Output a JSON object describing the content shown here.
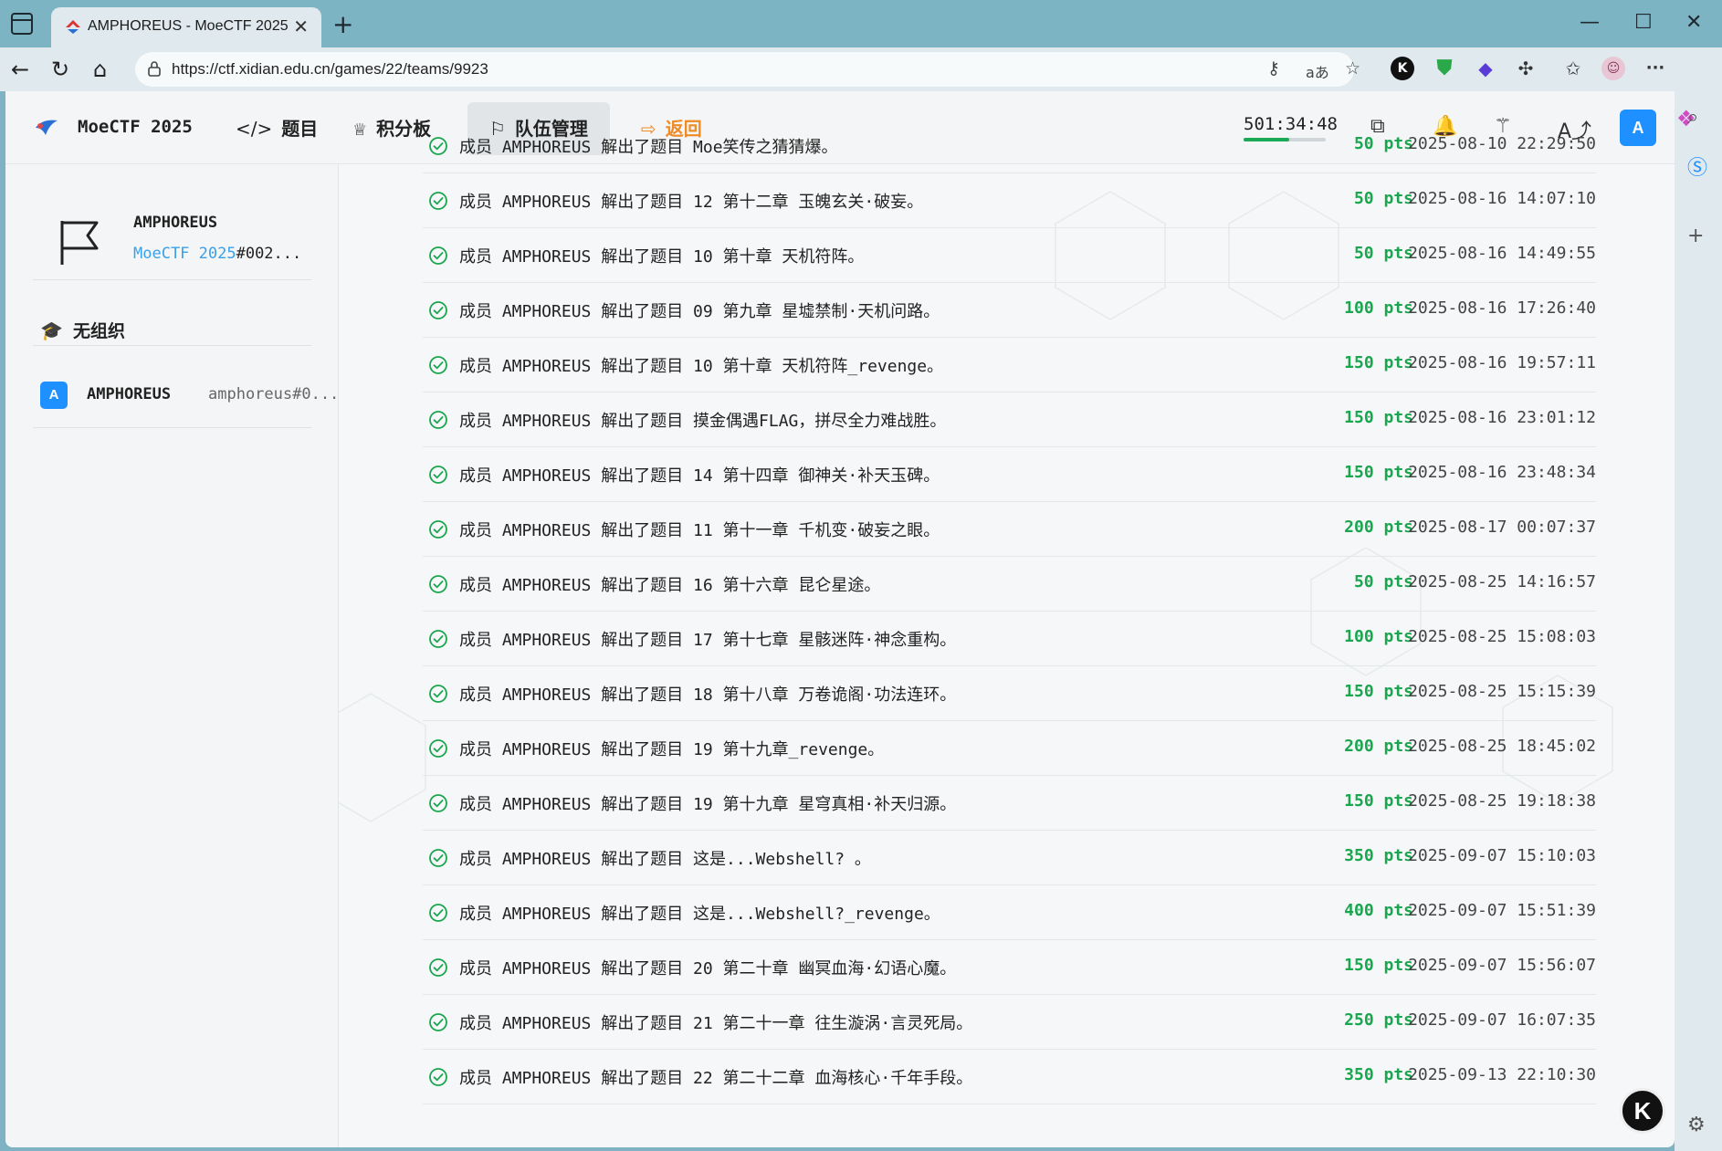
{
  "browser": {
    "tab_title": "AMPHOREUS - MoeCTF 2025",
    "tab_close": "✕",
    "new_tab": "+",
    "url": "https://ctf.xidian.edu.cn/games/22/teams/9923",
    "window_controls": [
      "—",
      "☐",
      "✕"
    ]
  },
  "nav": {
    "brand": "MoeCTF 2025",
    "items": [
      {
        "icon": "code-icon",
        "glyph": "</>",
        "label": "题目"
      },
      {
        "icon": "trophy-icon",
        "glyph": "🏆",
        "label": "积分板"
      },
      {
        "icon": "flag-icon",
        "glyph": "⚐",
        "label": "队伍管理"
      },
      {
        "icon": "exit-icon",
        "glyph": "⇨",
        "label": "返回"
      }
    ],
    "timer": "501:34:48",
    "timer_progress": 0.56,
    "avatar_letter": "A"
  },
  "team": {
    "name": "AMPHOREUS",
    "game": "MoeCTF 2025",
    "game_suffix": "#002...",
    "org": "无组织",
    "members": [
      {
        "letter": "A",
        "name": "AMPHOREUS",
        "handle": "amphoreus#0..."
      }
    ]
  },
  "events": [
    {
      "text": "成员 AMPHOREUS 解出了题目 Moe笑传之猜猜爆。",
      "pts": "50 pts",
      "time": "2025-08-10 22:29:50"
    },
    {
      "text": "成员 AMPHOREUS 解出了题目 12 第十二章 玉魄玄关·破妄。",
      "pts": "50 pts",
      "time": "2025-08-16 14:07:10"
    },
    {
      "text": "成员 AMPHOREUS 解出了题目 10 第十章 天机符阵。",
      "pts": "50 pts",
      "time": "2025-08-16 14:49:55"
    },
    {
      "text": "成员 AMPHOREUS 解出了题目 09 第九章 星墟禁制·天机问路。",
      "pts": "100 pts",
      "time": "2025-08-16 17:26:40"
    },
    {
      "text": "成员 AMPHOREUS 解出了题目 10 第十章 天机符阵_revenge。",
      "pts": "150 pts",
      "time": "2025-08-16 19:57:11"
    },
    {
      "text": "成员 AMPHOREUS 解出了题目 摸金偶遇FLAG，拼尽全力难战胜。",
      "pts": "150 pts",
      "time": "2025-08-16 23:01:12"
    },
    {
      "text": "成员 AMPHOREUS 解出了题目 14 第十四章 御神关·补天玉碑。",
      "pts": "150 pts",
      "time": "2025-08-16 23:48:34"
    },
    {
      "text": "成员 AMPHOREUS 解出了题目 11 第十一章 千机变·破妄之眼。",
      "pts": "200 pts",
      "time": "2025-08-17 00:07:37"
    },
    {
      "text": "成员 AMPHOREUS 解出了题目 16 第十六章 昆仑星途。",
      "pts": "50 pts",
      "time": "2025-08-25 14:16:57"
    },
    {
      "text": "成员 AMPHOREUS 解出了题目 17 第十七章 星骸迷阵·神念重构。",
      "pts": "100 pts",
      "time": "2025-08-25 15:08:03"
    },
    {
      "text": "成员 AMPHOREUS 解出了题目 18 第十八章 万卷诡阁·功法连环。",
      "pts": "150 pts",
      "time": "2025-08-25 15:15:39"
    },
    {
      "text": "成员 AMPHOREUS 解出了题目 19 第十九章_revenge。",
      "pts": "200 pts",
      "time": "2025-08-25 18:45:02"
    },
    {
      "text": "成员 AMPHOREUS 解出了题目 19 第十九章 星穹真相·补天归源。",
      "pts": "150 pts",
      "time": "2025-08-25 19:18:38"
    },
    {
      "text": "成员 AMPHOREUS 解出了题目 这是...Webshell? 。",
      "pts": "350 pts",
      "time": "2025-09-07 15:10:03"
    },
    {
      "text": "成员 AMPHOREUS 解出了题目 这是...Webshell?_revenge。",
      "pts": "400 pts",
      "time": "2025-09-07 15:51:39"
    },
    {
      "text": "成员 AMPHOREUS 解出了题目 20 第二十章 幽冥血海·幻语心魔。",
      "pts": "150 pts",
      "time": "2025-09-07 15:56:07"
    },
    {
      "text": "成员 AMPHOREUS 解出了题目 21 第二十一章 往生漩涡·言灵死局。",
      "pts": "250 pts",
      "time": "2025-09-07 16:07:35"
    },
    {
      "text": "成员 AMPHOREUS 解出了题目 22 第二十二章 血海核心·千年手段。",
      "pts": "350 pts",
      "time": "2025-09-13 22:10:30"
    }
  ],
  "floating_button": "K",
  "colors": {
    "accent": "#1e90ff",
    "points": "#1aa64f",
    "back": "#f08a24"
  }
}
